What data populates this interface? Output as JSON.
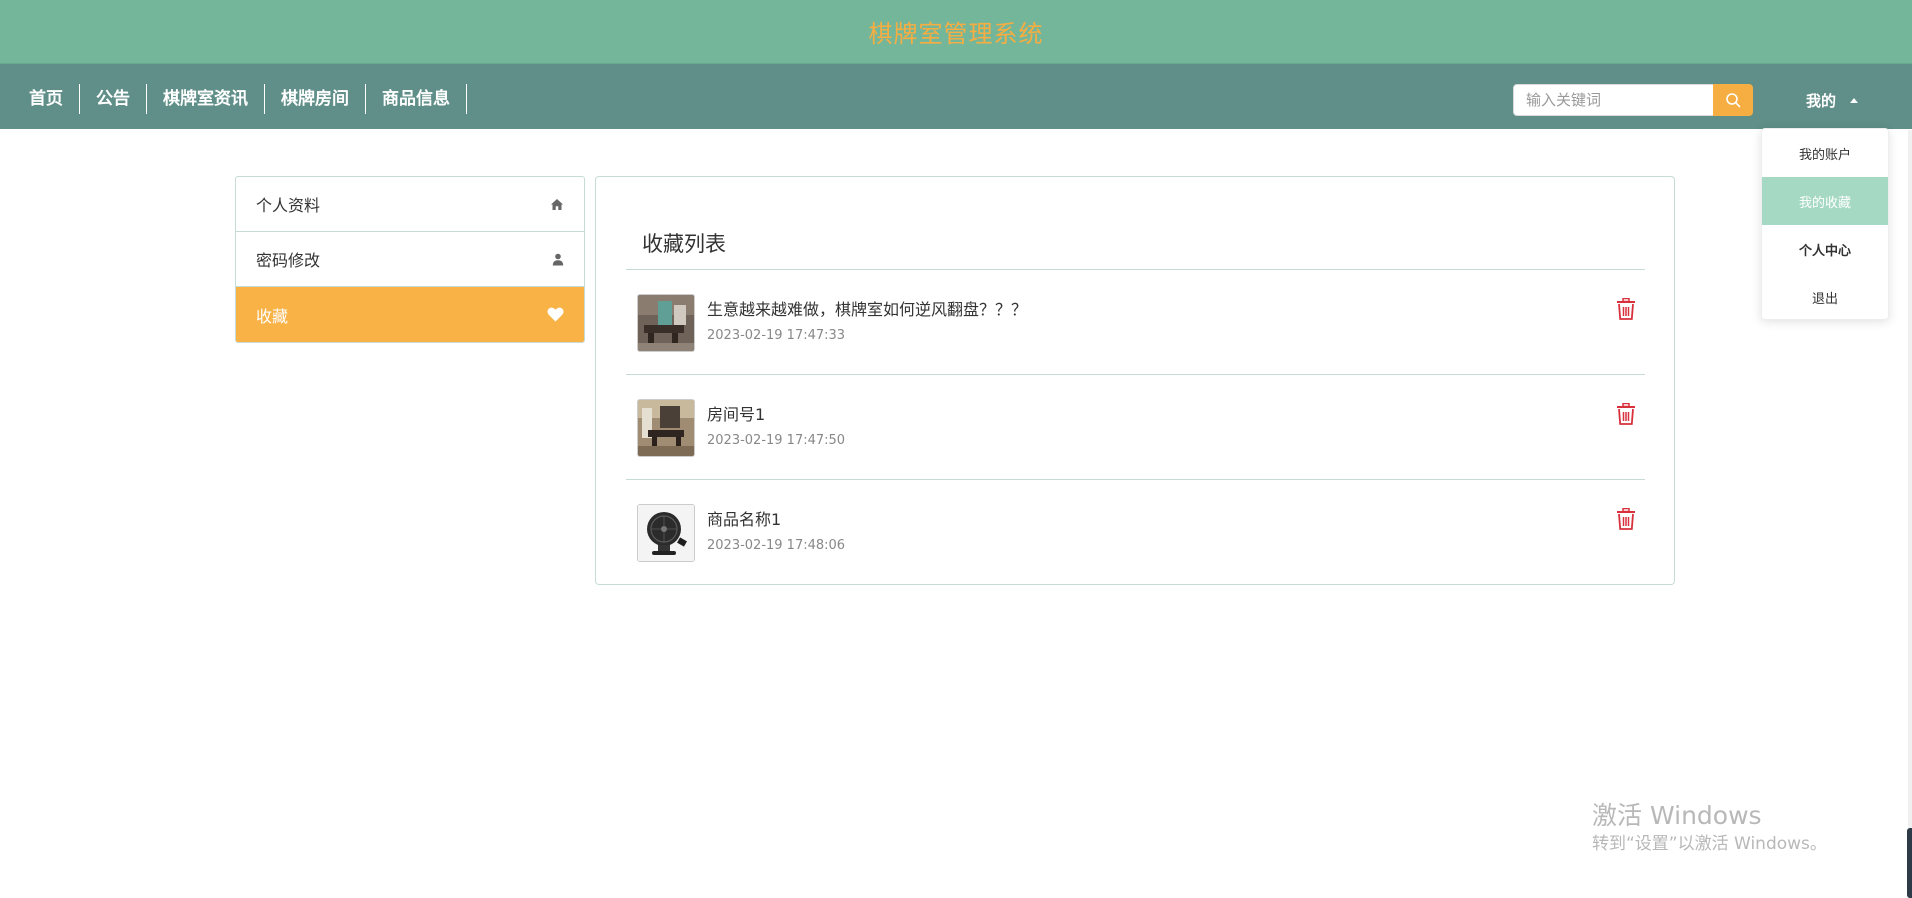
{
  "header": {
    "site_title": "棋牌室管理系统"
  },
  "nav": {
    "items": [
      "首页",
      "公告",
      "棋牌室资讯",
      "棋牌房间",
      "商品信息"
    ]
  },
  "search": {
    "placeholder": "输入关键词"
  },
  "user_menu": {
    "label": "我的",
    "dropdown": [
      "我的账户",
      "我的收藏",
      "个人中心",
      "退出"
    ]
  },
  "sidebar": {
    "items": [
      {
        "label": "个人资料",
        "icon": "home-icon"
      },
      {
        "label": "密码修改",
        "icon": "user-icon"
      },
      {
        "label": "收藏",
        "icon": "heart-icon",
        "active": true
      }
    ]
  },
  "favorites": {
    "title": "收藏列表",
    "items": [
      {
        "title": "生意越来越难做，棋牌室如何逆风翻盘？？？",
        "time": "2023-02-19 17:47:33",
        "thumb": "room-photo"
      },
      {
        "title": "房间号1",
        "time": "2023-02-19 17:47:50",
        "thumb": "room-photo"
      },
      {
        "title": "商品名称1",
        "time": "2023-02-19 17:48:06",
        "thumb": "fan-photo"
      }
    ]
  },
  "watermark": {
    "title": "激活 Windows",
    "subtitle": "转到“设置”以激活 Windows。"
  },
  "colors": {
    "title_bar": "#74b69a",
    "nav_bar": "#5f8f88",
    "accent_orange": "#f6ad42",
    "dropdown_active": "#a6d9c3",
    "delete_red": "#d8313d"
  }
}
